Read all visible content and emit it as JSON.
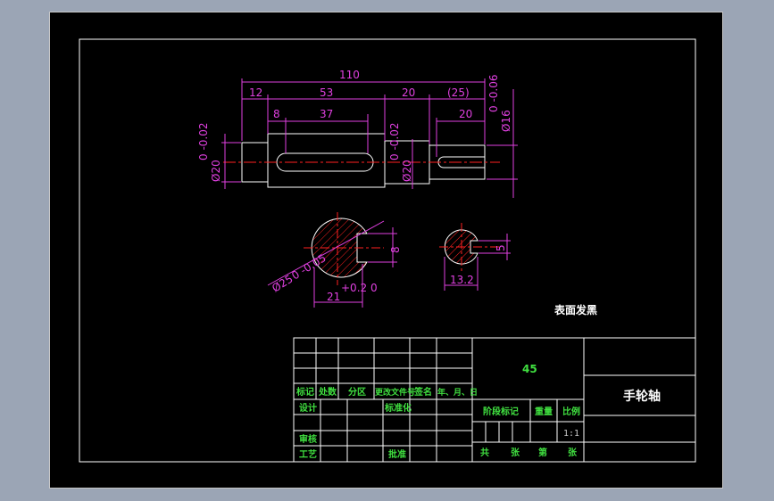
{
  "dimensions": {
    "overall": "110",
    "seg1": "12",
    "seg2": "53",
    "seg3": "20",
    "seg4": "(25)",
    "key_offset": "8",
    "key_length": "37",
    "end_key_length": "20",
    "dia_left": "Ø20",
    "tol_left": "0 -0.02",
    "dia_mid": "Ø20",
    "tol_mid": "0 -0.02",
    "dia_right": "Ø16",
    "tol_right": "0 -0.06",
    "sec1_dia": "Ø25",
    "sec1_tol": "0 -0.05",
    "sec1_width": "8",
    "sec1_depth": "21",
    "sec1_depth_tol": "+0.2 0",
    "sec2_width": "5",
    "sec2_depth": "13.2"
  },
  "note": "表面发黑",
  "title_block": {
    "material": "45",
    "part_name": "手轮轴",
    "scale": "1:1",
    "headers": [
      "标记",
      "处数",
      "分区",
      "更改文件号",
      "签名",
      "年、月、日"
    ],
    "design_label": "设计",
    "standard_label": "标准化",
    "review_label": "审核",
    "process_label": "工艺",
    "approve_label": "批准",
    "stage_label": "阶段标记",
    "weight_label": "重量",
    "scale_label": "比例",
    "total_label": "共",
    "sheet_label": "张",
    "page_label": "第",
    "page_label2": "张"
  }
}
